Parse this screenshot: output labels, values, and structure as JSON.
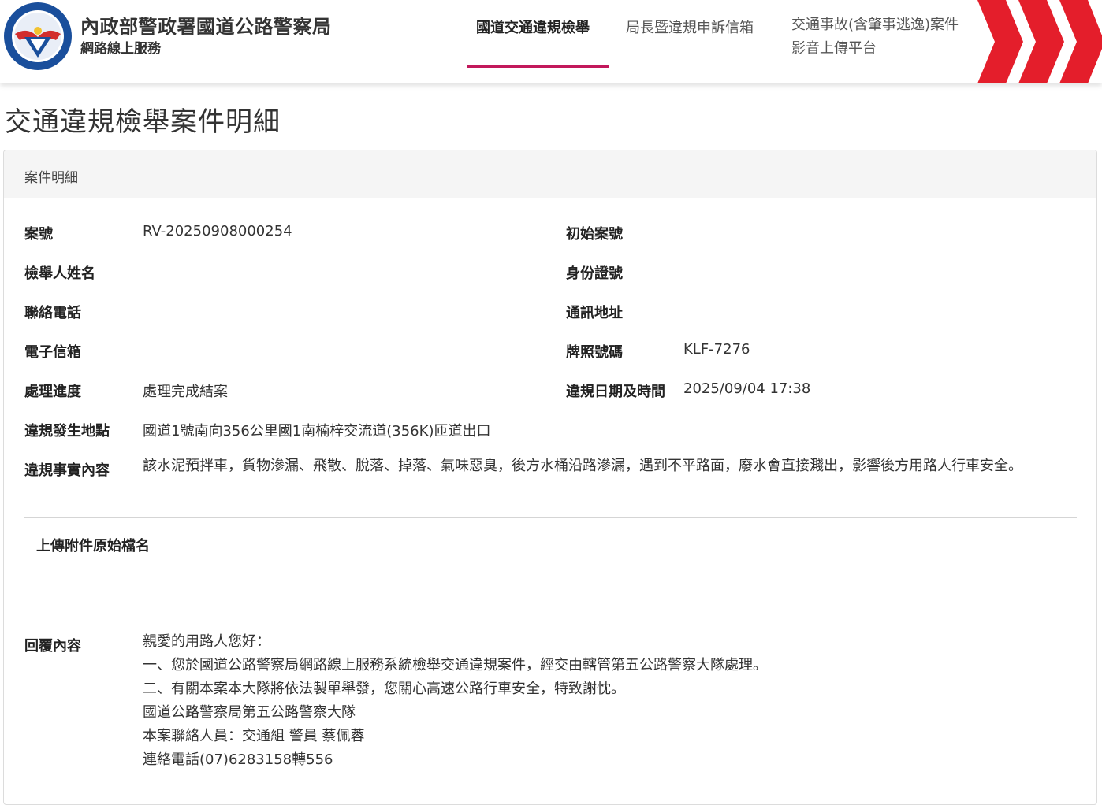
{
  "header": {
    "logo_icon": "police-emblem-icon",
    "org_title": "內政部警政署國道公路警察局",
    "org_subtitle": "網路線上服務",
    "nav": [
      {
        "label": "國道交通違規檢舉",
        "active": true
      },
      {
        "label": "局長暨違規申訴信箱",
        "active": false
      },
      {
        "label_line1": "交通事故(含肇事逃逸)案件",
        "label_line2": "影音上傳平台",
        "active": false
      }
    ],
    "accent_color": "#c2185b",
    "chevron_color": "#e41e2b"
  },
  "page_title": "交通違規檢舉案件明細",
  "card": {
    "header": "案件明細",
    "fields": {
      "case_no": {
        "label": "案號",
        "value": "RV-20250908000254"
      },
      "initial_case_no": {
        "label": "初始案號",
        "value": ""
      },
      "reporter_name": {
        "label": "檢舉人姓名",
        "value": ""
      },
      "id_no": {
        "label": "身份證號",
        "value": ""
      },
      "phone": {
        "label": "聯絡電話",
        "value": ""
      },
      "address": {
        "label": "通訊地址",
        "value": ""
      },
      "email": {
        "label": "電子信箱",
        "value": ""
      },
      "plate": {
        "label": "牌照號碼",
        "value": "KLF-7276"
      },
      "progress": {
        "label": "處理進度",
        "value": "處理完成結案"
      },
      "datetime": {
        "label": "違規日期及時間",
        "value": "2025/09/04 17:38"
      },
      "location": {
        "label": "違規發生地點",
        "value": "國道1號南向356公里國1南楠梓交流道(356K)匝道出口"
      },
      "facts": {
        "label": "違規事實內容",
        "value": "該水泥預拌車，貨物滲漏、飛散、脫落、掉落、氣味惡臭，後方水桶沿路滲漏，遇到不平路面，廢水會直接濺出，影響後方用路人行車安全。"
      }
    },
    "attachments_label": "上傳附件原始檔名",
    "reply": {
      "label": "回覆內容",
      "lines": [
        "親愛的用路人您好：",
        "一、您於國道公路警察局網路線上服務系統檢舉交通違規案件，經交由轄管第五公路警察大隊處理。",
        "二、有關本案本大隊將依法製單舉發，您關心高速公路行車安全，特致謝忱。",
        "國道公路警察局第五公路警察大隊",
        "本案聯絡人員：交通組 警員 蔡佩蓉",
        "連絡電話(07)6283158轉556"
      ]
    }
  }
}
